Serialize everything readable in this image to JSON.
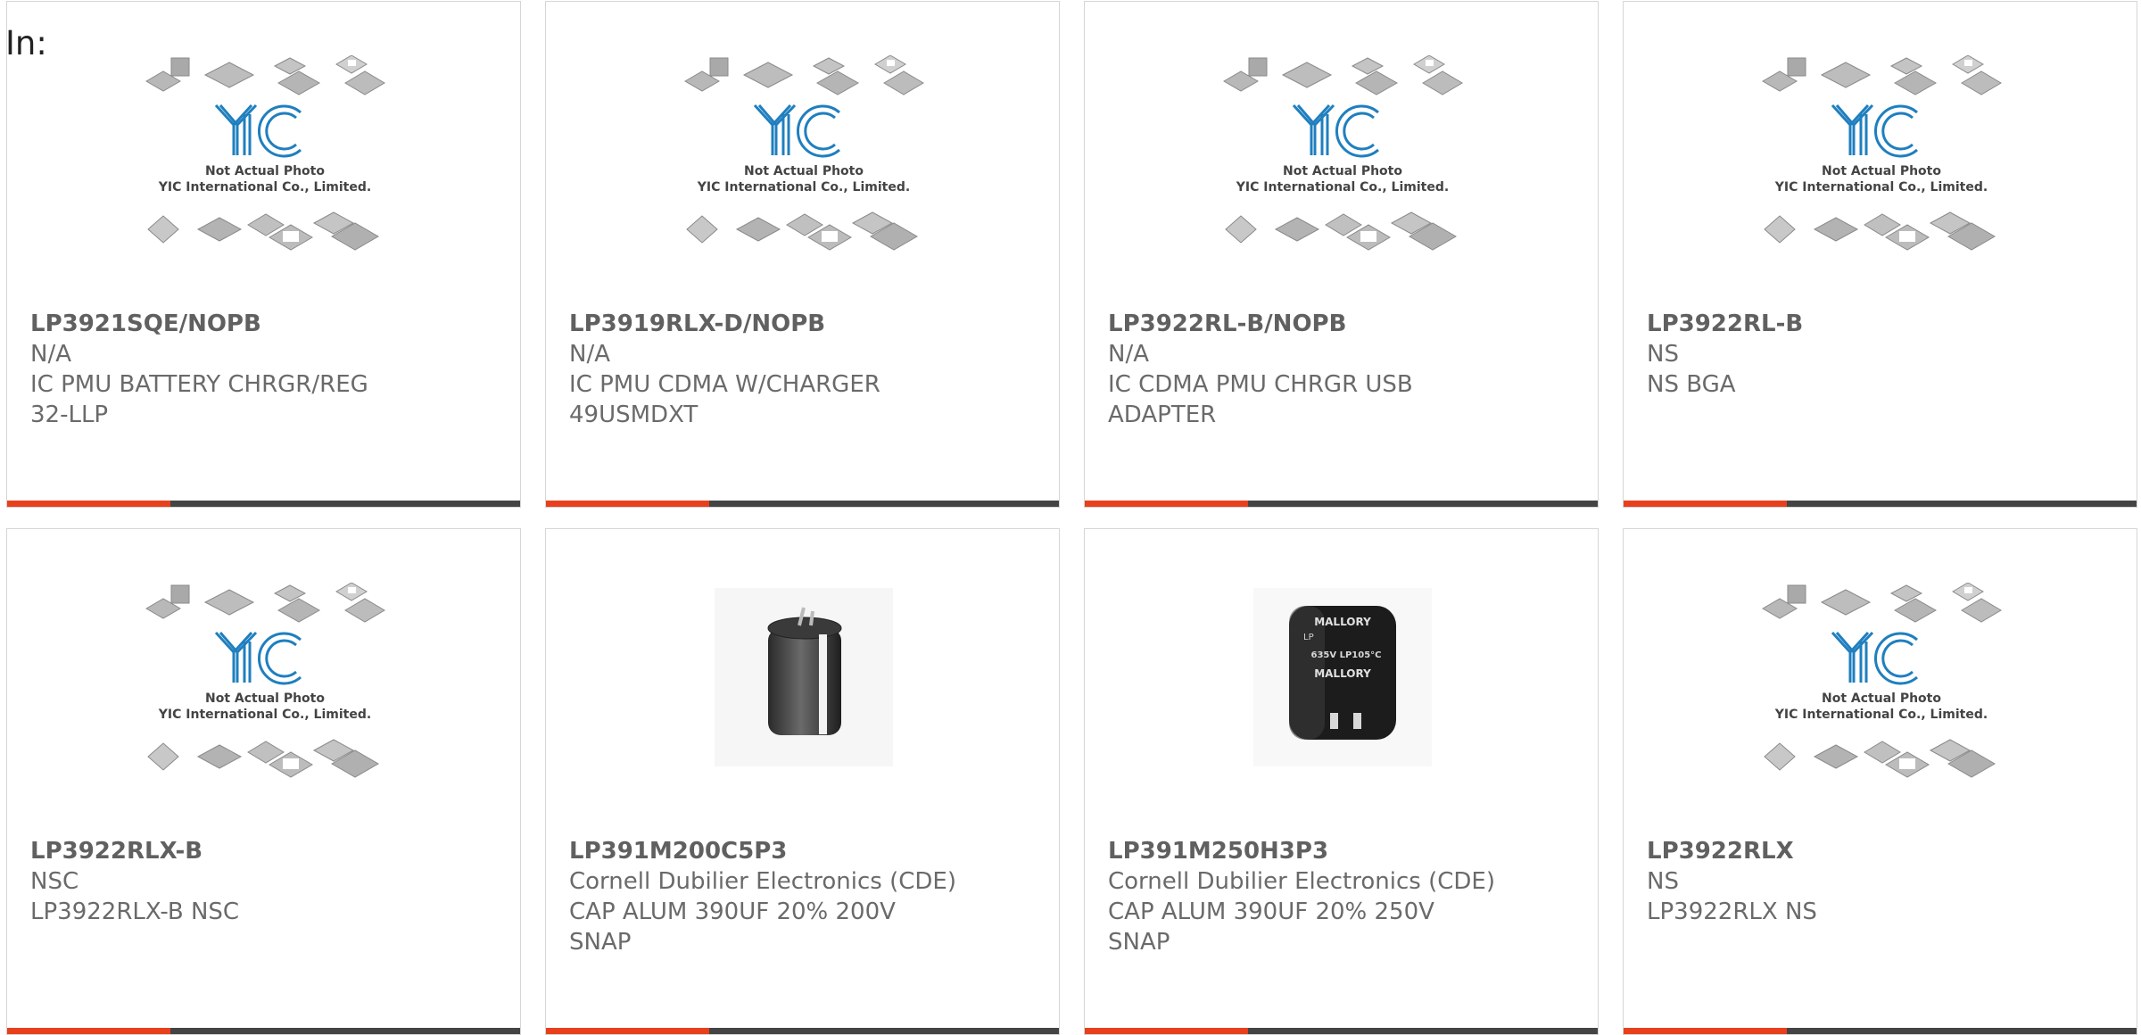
{
  "header": {
    "prefix": "In:"
  },
  "colors": {
    "accent": "#e8401c",
    "bar": "#444444",
    "logo_blue": "#1f7fbf"
  },
  "placeholder_image": {
    "caption_line1": "Not Actual Photo",
    "caption_line2": "YIC International Co., Limited.",
    "brand": "YIC"
  },
  "cards": [
    {
      "part": "LP3921SQE/NOPB",
      "manufacturer": "N/A",
      "description": "IC PMU BATTERY CHRGR/REG 32-LLP",
      "image": "placeholder"
    },
    {
      "part": "LP3919RLX-D/NOPB",
      "manufacturer": "N/A",
      "description": "IC PMU CDMA W/CHARGER 49USMDXT",
      "image": "placeholder"
    },
    {
      "part": "LP3922RL-B/NOPB",
      "manufacturer": "N/A",
      "description": "IC CDMA PMU CHRGR USB ADAPTER",
      "image": "placeholder"
    },
    {
      "part": "LP3922RL-B",
      "manufacturer": "NS",
      "description": "NS BGA",
      "image": "placeholder"
    },
    {
      "part": "LP3922RLX-B",
      "manufacturer": "NSC",
      "description": "LP3922RLX-B NSC",
      "image": "placeholder"
    },
    {
      "part": "LP391M200C5P3",
      "manufacturer": "Cornell Dubilier Electronics (CDE)",
      "description": "CAP ALUM 390UF 20% 200V SNAP",
      "image": "capacitor-cde"
    },
    {
      "part": "LP391M250H3P3",
      "manufacturer": "Cornell Dubilier Electronics (CDE)",
      "description": "CAP ALUM 390UF 20% 250V SNAP",
      "image": "capacitor-mallory",
      "capacitor_print": [
        "MALLORY",
        "LP",
        "635V LP105°C",
        "MALLORY"
      ]
    },
    {
      "part": "LP3922RLX",
      "manufacturer": "NS",
      "description": "LP3922RLX NS",
      "image": "placeholder"
    }
  ]
}
